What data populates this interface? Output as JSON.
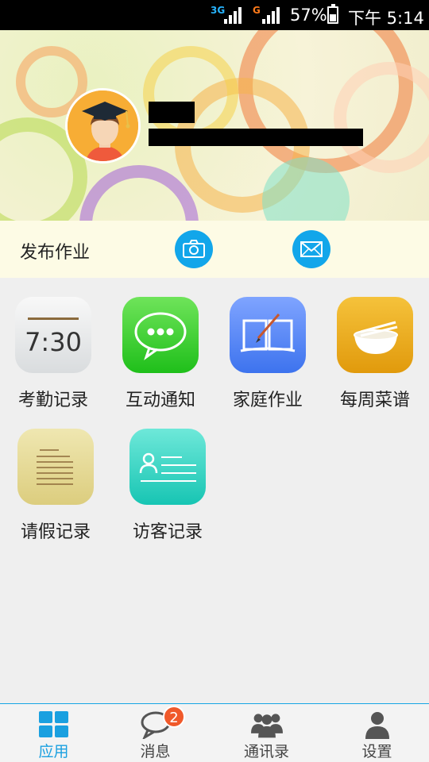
{
  "status_bar": {
    "network1": "3G",
    "network2": "G",
    "battery": "57%",
    "battery_level": 0.57,
    "time": "下午 5:14"
  },
  "profile": {
    "name": "",
    "school": ""
  },
  "publish": {
    "label": "发布作业",
    "camera_icon": "camera-icon",
    "mail_icon": "mail-icon"
  },
  "apps": [
    {
      "label": "考勤记录",
      "icon": "clock-icon",
      "clock_text": "7:30"
    },
    {
      "label": "互动通知",
      "icon": "chat-icon"
    },
    {
      "label": "家庭作业",
      "icon": "book-icon"
    },
    {
      "label": "每周菜谱",
      "icon": "bowl-icon"
    },
    {
      "label": "请假记录",
      "icon": "note-icon"
    },
    {
      "label": "访客记录",
      "icon": "visitor-card-icon"
    }
  ],
  "tabs": [
    {
      "label": "应用",
      "icon": "grid-icon",
      "active": true
    },
    {
      "label": "消息",
      "icon": "message-icon",
      "badge": "2"
    },
    {
      "label": "通讯录",
      "icon": "contacts-icon"
    },
    {
      "label": "设置",
      "icon": "person-icon"
    }
  ],
  "colors": {
    "accent": "#1aa0e0",
    "badge": "#f0592a",
    "publish_bg": "#fdfbe5"
  }
}
